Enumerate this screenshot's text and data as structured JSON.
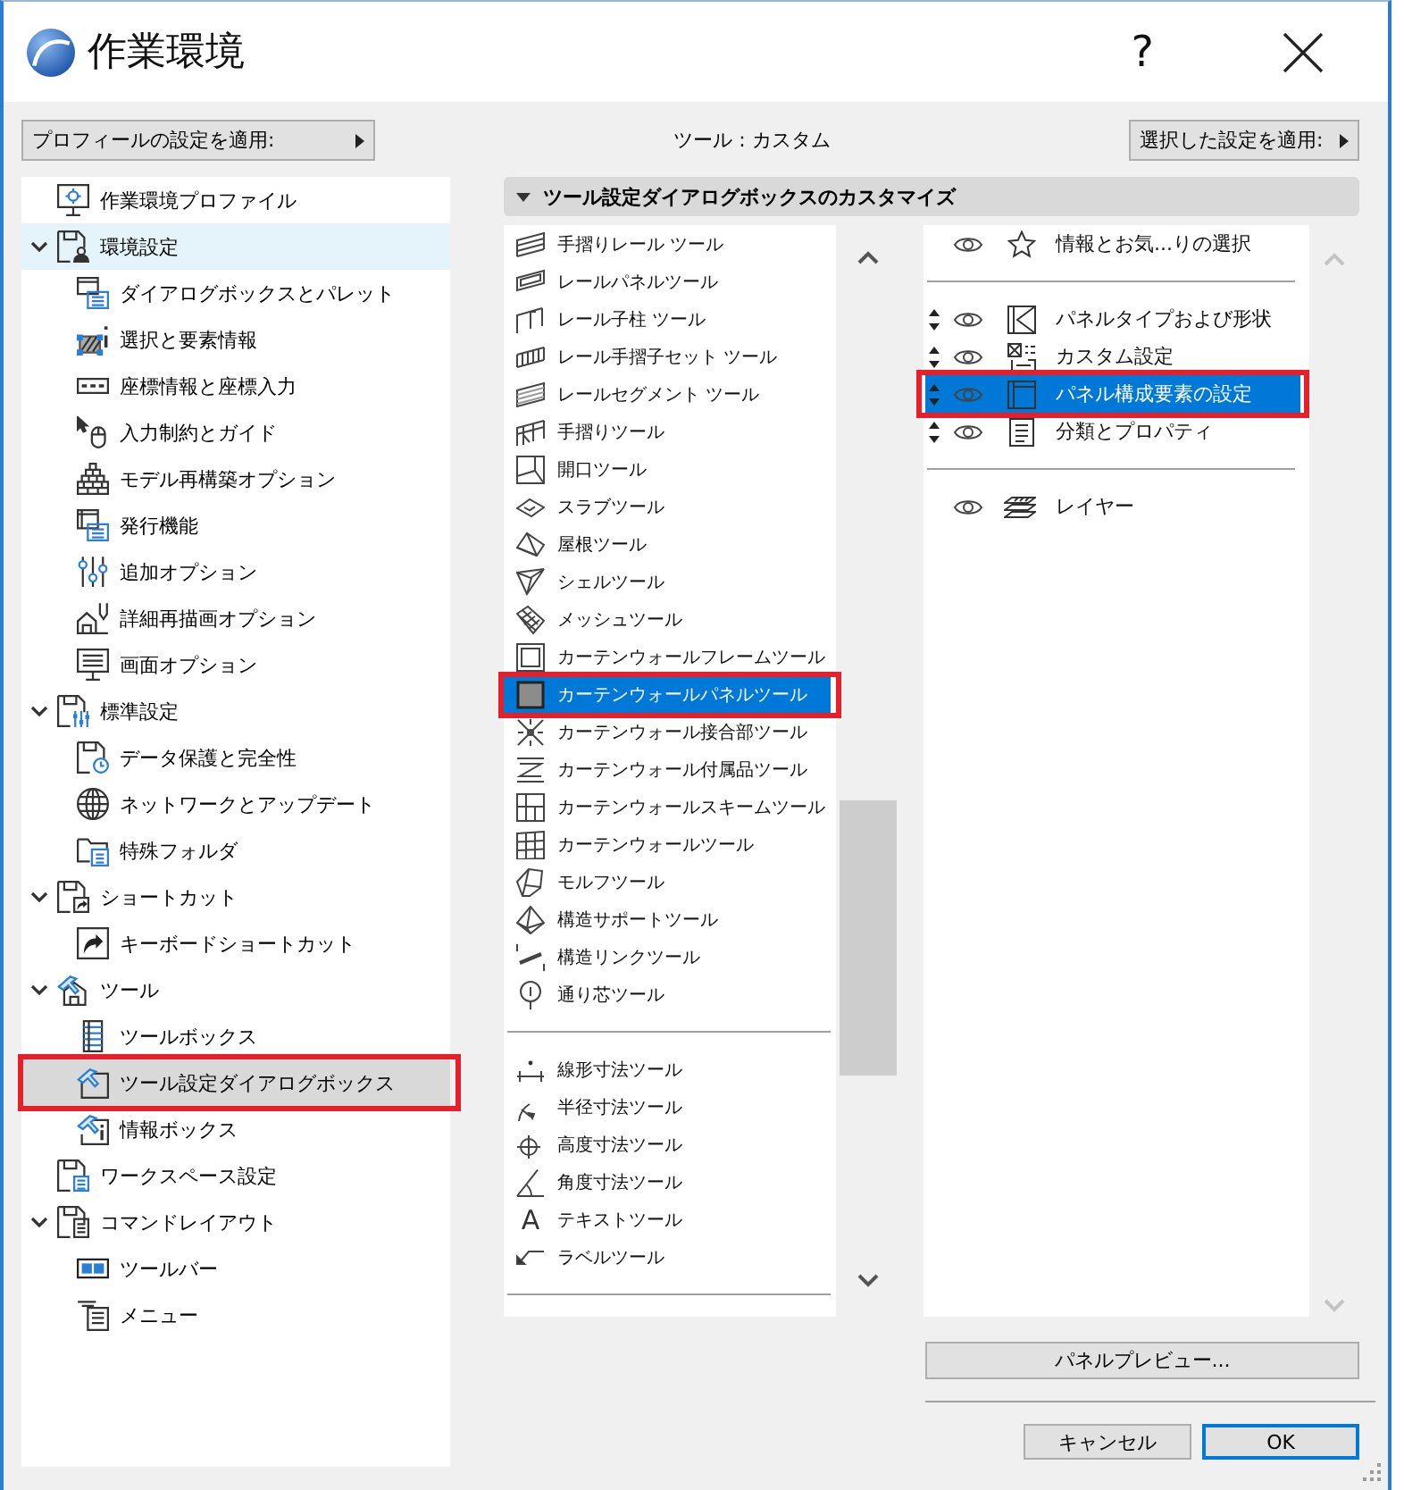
{
  "window": {
    "title": "作業環境",
    "help": "?"
  },
  "toolbar": {
    "profile_button": "プロフィールの設定を適用:",
    "status": "ツール : カスタム",
    "apply_button": "選択した設定を適用:"
  },
  "sidebar": {
    "items": [
      {
        "label": "作業環境プロファイル",
        "selected": false,
        "hovered": false,
        "annotated": false
      },
      {
        "label": "環境設定",
        "selected": false,
        "hovered": true,
        "annotated": false,
        "expanded": true,
        "children": [
          {
            "label": "ダイアログボックスとパレット",
            "selected": false,
            "hovered": false,
            "annotated": false
          },
          {
            "label": "選択と要素情報",
            "selected": false,
            "hovered": false,
            "annotated": false
          },
          {
            "label": "座標情報と座標入力",
            "selected": false,
            "hovered": false,
            "annotated": false
          },
          {
            "label": "入力制約とガイド",
            "selected": false,
            "hovered": false,
            "annotated": false
          },
          {
            "label": "モデル再構築オプション",
            "selected": false,
            "hovered": false,
            "annotated": false
          },
          {
            "label": "発行機能",
            "selected": false,
            "hovered": false,
            "annotated": false
          },
          {
            "label": "追加オプション",
            "selected": false,
            "hovered": false,
            "annotated": false
          },
          {
            "label": "詳細再描画オプション",
            "selected": false,
            "hovered": false,
            "annotated": false
          },
          {
            "label": "画面オプション",
            "selected": false,
            "hovered": false,
            "annotated": false
          }
        ]
      },
      {
        "label": "標準設定",
        "selected": false,
        "hovered": false,
        "annotated": false,
        "expanded": true,
        "children": [
          {
            "label": "データ保護と完全性",
            "selected": false,
            "hovered": false,
            "annotated": false
          },
          {
            "label": "ネットワークとアップデート",
            "selected": false,
            "hovered": false,
            "annotated": false
          },
          {
            "label": "特殊フォルダ",
            "selected": false,
            "hovered": false,
            "annotated": false
          }
        ]
      },
      {
        "label": "ショートカット",
        "selected": false,
        "hovered": false,
        "annotated": false,
        "expanded": true,
        "children": [
          {
            "label": "キーボードショートカット",
            "selected": false,
            "hovered": false,
            "annotated": false
          }
        ]
      },
      {
        "label": "ツール",
        "selected": false,
        "hovered": false,
        "annotated": false,
        "expanded": true,
        "children": [
          {
            "label": "ツールボックス",
            "selected": false,
            "hovered": false,
            "annotated": false
          },
          {
            "label": "ツール設定ダイアログボックス",
            "selected": true,
            "hovered": false,
            "annotated": true
          },
          {
            "label": "情報ボックス",
            "selected": false,
            "hovered": false,
            "annotated": false
          }
        ]
      },
      {
        "label": "ワークスペース設定",
        "selected": false,
        "hovered": false,
        "annotated": false
      },
      {
        "label": "コマンドレイアウト",
        "selected": false,
        "hovered": false,
        "annotated": false,
        "expanded": true,
        "children": [
          {
            "label": "ツールバー",
            "selected": false,
            "hovered": false,
            "annotated": false
          },
          {
            "label": "メニュー",
            "selected": false,
            "hovered": false,
            "annotated": false
          }
        ]
      }
    ]
  },
  "section": {
    "title": "ツール設定ダイアログボックスのカスタマイズ",
    "expanded": true
  },
  "tool_list": {
    "groups": [
      {
        "items": [
          {
            "label": "手摺りレール ツール",
            "selected": false,
            "annotated": false
          },
          {
            "label": "レールパネルツール",
            "selected": false,
            "annotated": false
          },
          {
            "label": "レール子柱 ツール",
            "selected": false,
            "annotated": false
          },
          {
            "label": "レール手摺子セット ツール",
            "selected": false,
            "annotated": false
          },
          {
            "label": "レールセグメント ツール",
            "selected": false,
            "annotated": false
          },
          {
            "label": "手摺りツール",
            "selected": false,
            "annotated": false
          },
          {
            "label": "開口ツール",
            "selected": false,
            "annotated": false
          },
          {
            "label": "スラブツール",
            "selected": false,
            "annotated": false
          },
          {
            "label": "屋根ツール",
            "selected": false,
            "annotated": false
          },
          {
            "label": "シェルツール",
            "selected": false,
            "annotated": false
          },
          {
            "label": "メッシュツール",
            "selected": false,
            "annotated": false
          },
          {
            "label": "カーテンウォールフレームツール",
            "selected": false,
            "annotated": false
          },
          {
            "label": "カーテンウォールパネルツール",
            "selected": true,
            "annotated": true
          },
          {
            "label": "カーテンウォール接合部ツール",
            "selected": false,
            "annotated": false
          },
          {
            "label": "カーテンウォール付属品ツール",
            "selected": false,
            "annotated": false
          },
          {
            "label": "カーテンウォールスキームツール",
            "selected": false,
            "annotated": false
          },
          {
            "label": "カーテンウォールツール",
            "selected": false,
            "annotated": false
          },
          {
            "label": "モルフツール",
            "selected": false,
            "annotated": false
          },
          {
            "label": "構造サポートツール",
            "selected": false,
            "annotated": false
          },
          {
            "label": "構造リンクツール",
            "selected": false,
            "annotated": false
          },
          {
            "label": "通り芯ツール",
            "selected": false,
            "annotated": false
          }
        ]
      },
      {
        "items": [
          {
            "label": "線形寸法ツール",
            "selected": false,
            "annotated": false
          },
          {
            "label": "半径寸法ツール",
            "selected": false,
            "annotated": false
          },
          {
            "label": "高度寸法ツール",
            "selected": false,
            "annotated": false
          },
          {
            "label": "角度寸法ツール",
            "selected": false,
            "annotated": false
          },
          {
            "label": "テキストツール",
            "selected": false,
            "annotated": false,
            "icon_glyph": "A"
          },
          {
            "label": "ラベルツール",
            "selected": false,
            "annotated": false
          }
        ]
      }
    ]
  },
  "panel_list": {
    "groups": [
      {
        "items": [
          {
            "label": "情報とお気...りの選択",
            "visible": true,
            "reorderable": false,
            "selected": false,
            "annotated": false
          }
        ]
      },
      {
        "items": [
          {
            "label": "パネルタイプおよび形状",
            "visible": true,
            "reorderable": true,
            "selected": false,
            "annotated": false
          },
          {
            "label": "カスタム設定",
            "visible": true,
            "reorderable": true,
            "selected": false,
            "annotated": false
          },
          {
            "label": "パネル構成要素の設定",
            "visible": true,
            "reorderable": true,
            "selected": true,
            "annotated": true
          },
          {
            "label": "分類とプロパティ",
            "visible": true,
            "reorderable": true,
            "selected": false,
            "annotated": false
          }
        ]
      },
      {
        "items": [
          {
            "label": "レイヤー",
            "visible": true,
            "reorderable": false,
            "selected": false,
            "annotated": false
          }
        ]
      }
    ]
  },
  "footer": {
    "preview_button": "パネルプレビュー...",
    "buttons": [
      {
        "label": "キャンセル",
        "default": false
      },
      {
        "label": "OK",
        "default": true
      }
    ]
  }
}
